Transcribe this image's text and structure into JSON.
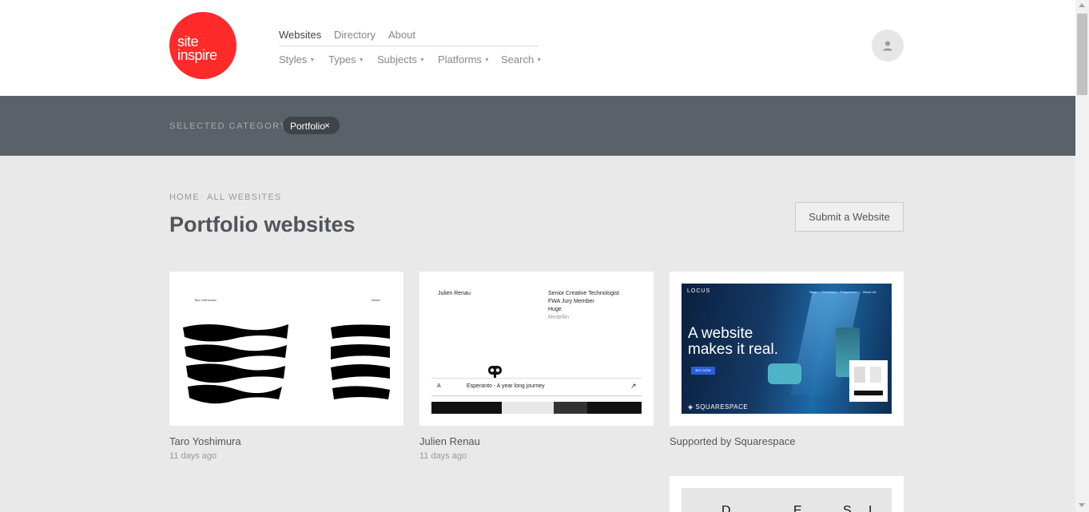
{
  "logo": {
    "line1": "site",
    "line2": "inspire"
  },
  "nav": {
    "primary": [
      "Websites",
      "Directory",
      "About"
    ],
    "secondary": [
      "Styles",
      "Types",
      "Subjects",
      "Platforms",
      "Search"
    ]
  },
  "category": {
    "label": "SELECTED CATEGORY",
    "selected": "Portfolio",
    "remove": "×"
  },
  "breadcrumb": {
    "home": "HOME",
    "separator": "·",
    "current": "ALL WEBSITES"
  },
  "page_title": "Portfolio websites",
  "submit_label": "Submit a Website",
  "cards": [
    {
      "name": "Taro Yoshimura",
      "date": "11 days ago",
      "preview": {
        "site_name": "Taro Yoshimura",
        "link": "About"
      }
    },
    {
      "name": "Julien Renau",
      "date": "11 days ago",
      "preview": {
        "site_name": "Julien Renau",
        "role_lines": [
          "Senior Creative Technologist",
          "FWA Jury Member",
          "Huge"
        ],
        "location": "Medellin",
        "bottom_letter": "A",
        "bottom_text": "Esperanto - A year long journey",
        "arrow": "↗"
      }
    },
    {
      "name": "Supported by Squarespace",
      "preview": {
        "brand": "LOCUS",
        "menu": [
          "Shop",
          "Grooming",
          "Fragrances",
          "About Us"
        ],
        "headline_1": "A website",
        "headline_2": "makes it real.",
        "cta": "BUY NOW",
        "sponsor": "SQUARESPACE"
      }
    },
    {
      "preview": {
        "letters": [
          "D",
          "E",
          "S",
          "I"
        ]
      }
    }
  ],
  "colors": {
    "brand_red": "#ff2a2a",
    "category_bar": "#5b6168",
    "page_bg": "#e9e9e9"
  }
}
